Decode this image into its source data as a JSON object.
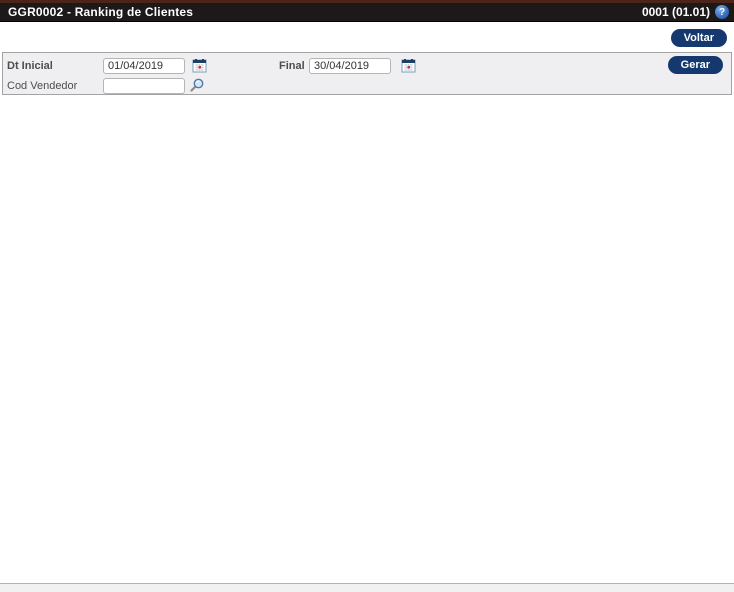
{
  "header": {
    "title": "GGR0002 - Ranking de Clientes",
    "version": "0001 (01.01)",
    "help_label": "?"
  },
  "toolbar": {
    "voltar_label": "Voltar"
  },
  "form": {
    "dt_inicial": {
      "label": "Dt Inicial",
      "value": "01/04/2019"
    },
    "final": {
      "label": "Final",
      "value": "30/04/2019"
    },
    "cod_vendedor": {
      "label": "Cod Vendedor",
      "value": ""
    },
    "gerar_label": "Gerar",
    "icons": {
      "dt_inicial_icon": "calendar-icon",
      "final_icon": "calendar-icon",
      "cod_vendedor_icon": "magnifier-icon"
    }
  },
  "colors": {
    "top_line": "#4d241a",
    "header_bg": "#1d1919",
    "button_navy": "#15386e",
    "panel_bg": "#efeef0",
    "panel_border": "#a3a3a3"
  }
}
